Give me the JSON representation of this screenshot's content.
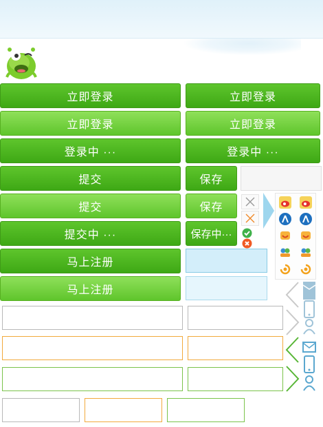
{
  "buttons": {
    "login": "立即登录",
    "logging_in": "登录中 ···",
    "submit": "提交",
    "submitting": "提交中 ···",
    "save": "保存",
    "saving": "保存中···",
    "register": "马上注册"
  },
  "icons": {
    "mascot": "green-monster-mascot",
    "close": "close-icon",
    "check": "check-icon",
    "error": "error-icon",
    "weibo": "weibo-icon",
    "renren": "renren-icon",
    "kaixin": "kaixin-icon",
    "douban": "douban-icon",
    "qq_weibo": "qq-weibo-icon",
    "mail": "mail-icon",
    "phone": "phone-icon",
    "user": "user-icon",
    "chevron": "chevron-left-icon"
  },
  "colors": {
    "button_green": "#3ea815",
    "button_green_light": "#8fe05a",
    "focus_orange": "#f2a93b",
    "valid_green": "#7ac34a",
    "hint_blue": "#88cbe5"
  }
}
